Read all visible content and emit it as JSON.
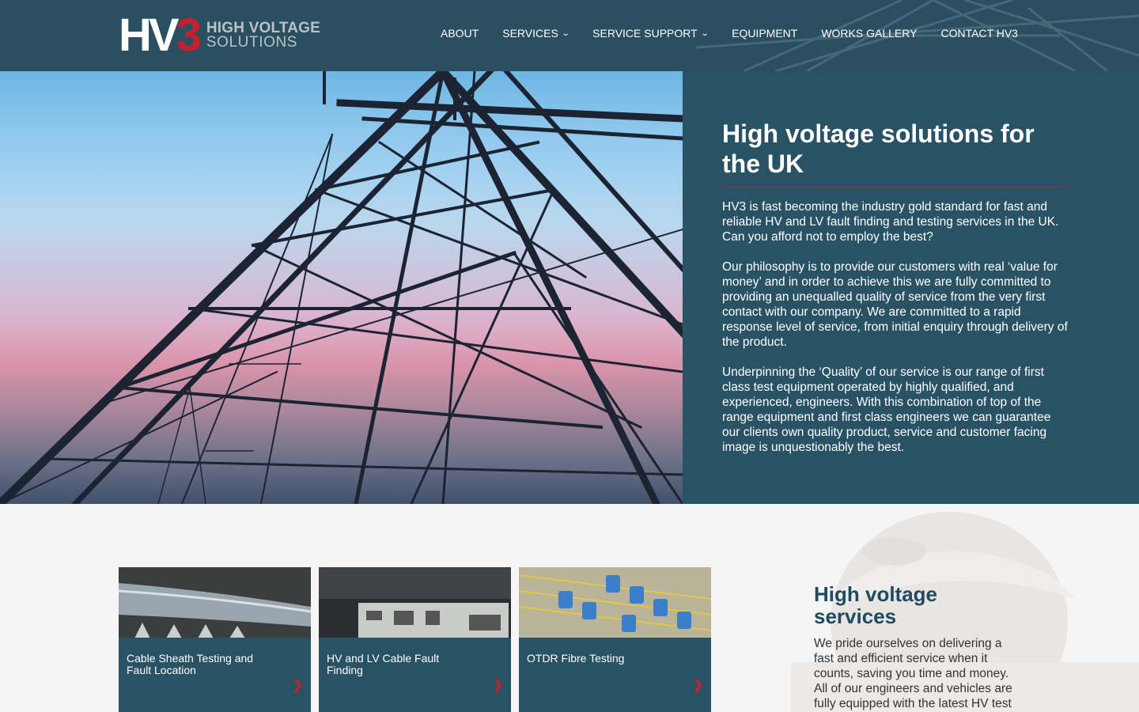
{
  "header": {
    "logo": {
      "mark": "HV",
      "mark_number": "3",
      "line1": "HIGH VOLTAGE",
      "line2": "SOLUTIONS"
    },
    "nav": [
      {
        "label": "ABOUT",
        "dropdown": false
      },
      {
        "label": "SERVICES",
        "dropdown": true
      },
      {
        "label": "SERVICE SUPPORT",
        "dropdown": true
      },
      {
        "label": "EQUIPMENT",
        "dropdown": false
      },
      {
        "label": "WORKS GALLERY",
        "dropdown": false
      },
      {
        "label": "CONTACT HV3",
        "dropdown": false
      }
    ]
  },
  "hero": {
    "title": "High voltage solutions for the UK",
    "paragraphs": [
      "HV3 is fast becoming the industry gold standard for fast and reliable HV and LV fault finding and testing services in the UK.  Can you afford not to employ the best?",
      "Our philosophy is to provide our customers with real ‘value for money’ and in order to achieve this we are fully committed to providing an unequalled quality of service from the very first contact with our company.  We are committed to a rapid response level of service, from initial enquiry through delivery of the product.",
      "Underpinning the ‘Quality’ of our service is our range of first class test equipment operated by highly qualified, and experienced, engineers.   With this combination of top of the range equipment and first class engineers we can guarantee our clients own quality product, service and customer facing image is unquestionably the best."
    ]
  },
  "services": {
    "cards": [
      {
        "label": "Cable Sheath Testing and Fault Location",
        "arrow": "❯"
      },
      {
        "label": "HV and LV Cable Fault Finding",
        "arrow": "❯"
      },
      {
        "label": "OTDR Fibre Testing",
        "arrow": "❯"
      }
    ],
    "title": "High voltage services",
    "body": "We pride ourselves on delivering a fast and efficient service when it counts, saving you time and money. All of our engineers and vehicles are fully equipped with the latest HV test"
  },
  "colors": {
    "navy": "#2a5265",
    "header": "#2a4f60",
    "accent_red": "#c8202a"
  }
}
